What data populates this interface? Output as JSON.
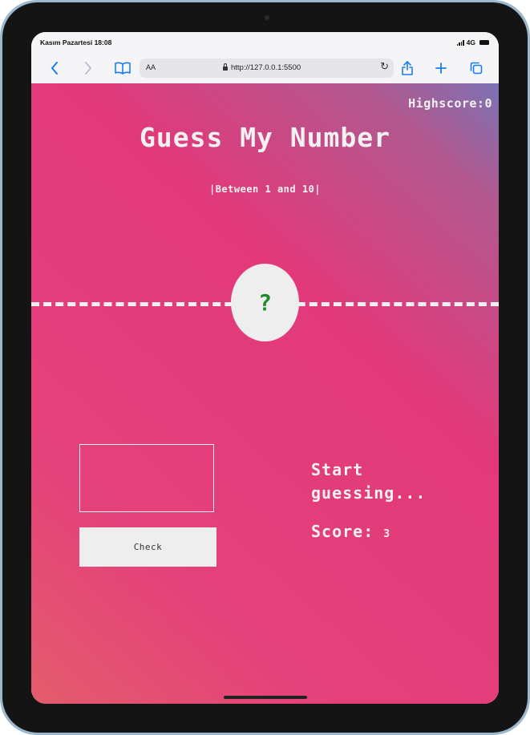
{
  "status_bar": {
    "time": "Kasım Pazartesi 18:08",
    "network": "4G"
  },
  "browser": {
    "back_icon": "chevron-left-icon",
    "forward_icon": "chevron-right-icon",
    "bookmarks_icon": "book-icon",
    "text_size_label": "AA",
    "url": "http://127.0.0.1:5500",
    "reload_icon": "reload-icon",
    "share_icon": "share-icon",
    "new_tab_icon": "plus-icon",
    "tabs_icon": "tabs-icon"
  },
  "game": {
    "highscore_label": "Highscore:",
    "highscore_value": "0",
    "title": "Guess My Number",
    "range_hint": "|Between 1 and 10|",
    "secret_number": "?",
    "guess_value": "",
    "check_label": "Check",
    "message": "Start guessing...",
    "score_label": "Score:",
    "score_value": "3"
  },
  "colors": {
    "accent_browser": "#1a7cf5",
    "secret_text": "#1f8a2a",
    "gradient_top_right": "#7c73b4",
    "gradient_main": "#e2397a",
    "gradient_bottom_left": "#e45c6c"
  }
}
